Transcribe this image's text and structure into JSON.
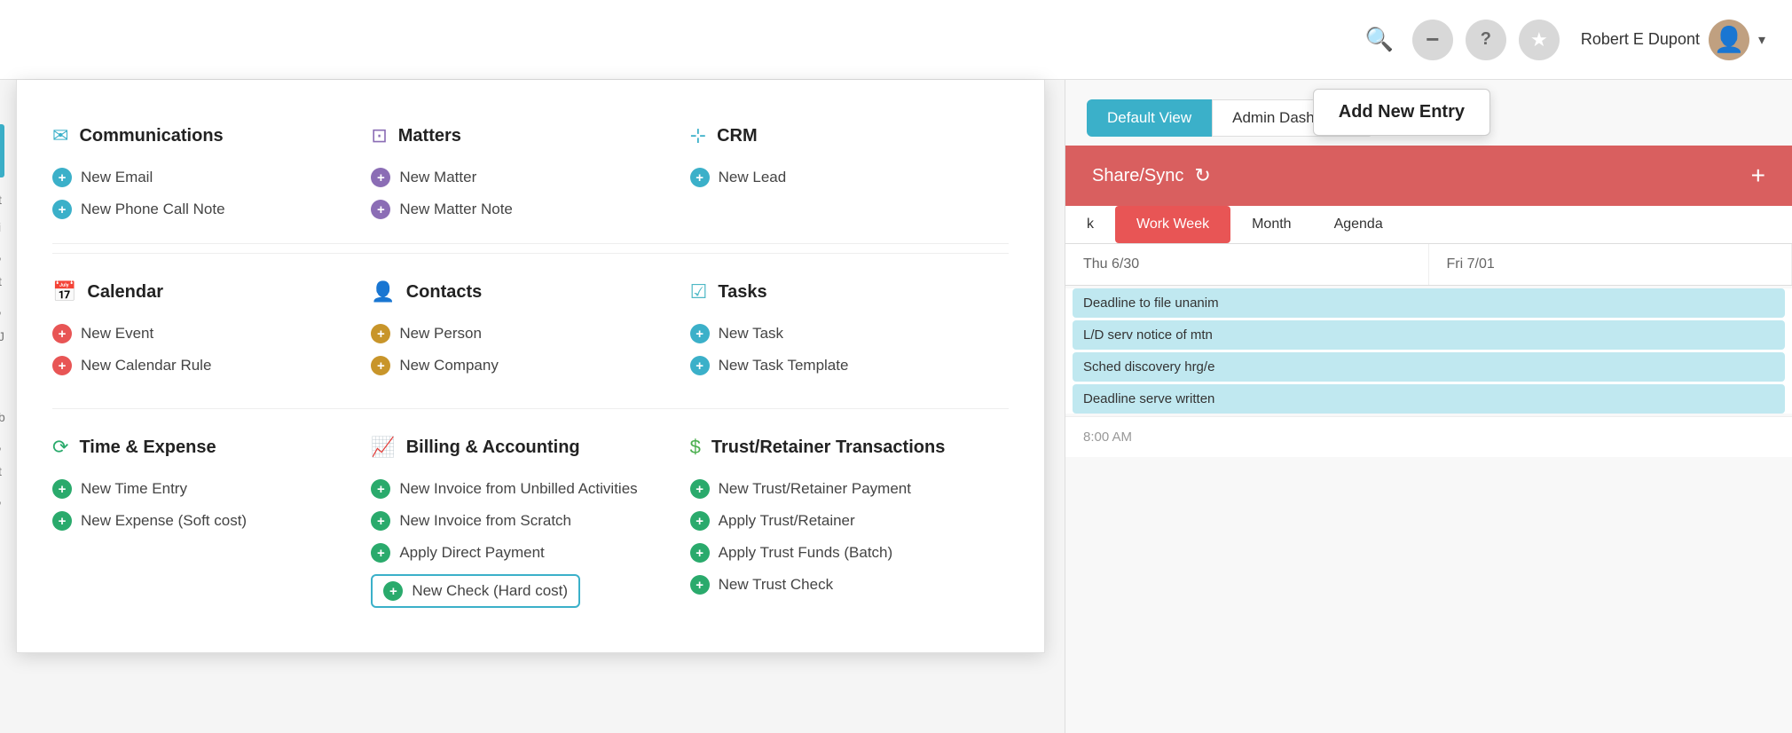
{
  "header": {
    "user_name": "Robert E Dupont",
    "search_icon": "🔍",
    "minus_icon": "−",
    "help_icon": "?",
    "star_icon": "★",
    "chevron": "▾"
  },
  "add_new_entry": {
    "label": "Add New Entry"
  },
  "categories": {
    "communications": {
      "title": "Communications",
      "items": [
        {
          "label": "New Email",
          "color": "teal"
        },
        {
          "label": "New Phone Call Note",
          "color": "teal"
        }
      ]
    },
    "matters": {
      "title": "Matters",
      "items": [
        {
          "label": "New Matter",
          "color": "purple"
        },
        {
          "label": "New Matter Note",
          "color": "purple"
        }
      ]
    },
    "crm": {
      "title": "CRM",
      "items": [
        {
          "label": "New Lead",
          "color": "teal"
        }
      ]
    },
    "calendar": {
      "title": "Calendar",
      "items": [
        {
          "label": "New Event",
          "color": "red"
        },
        {
          "label": "New Calendar Rule",
          "color": "red"
        }
      ]
    },
    "contacts": {
      "title": "Contacts",
      "items": [
        {
          "label": "New Person",
          "color": "gold"
        },
        {
          "label": "New Company",
          "color": "gold"
        }
      ]
    },
    "tasks": {
      "title": "Tasks",
      "items": [
        {
          "label": "New Task",
          "color": "teal"
        },
        {
          "label": "New Task Template",
          "color": "teal"
        }
      ]
    },
    "time_expense": {
      "title": "Time & Expense",
      "items": [
        {
          "label": "New Time Entry",
          "color": "green"
        },
        {
          "label": "New Expense (Soft cost)",
          "color": "green"
        }
      ]
    },
    "billing": {
      "title": "Billing & Accounting",
      "items": [
        {
          "label": "New Invoice from Unbilled Activities",
          "color": "green"
        },
        {
          "label": "New Invoice from Scratch",
          "color": "green"
        },
        {
          "label": "Apply Direct Payment",
          "color": "green"
        },
        {
          "label": "New Check (Hard cost)",
          "color": "green",
          "highlighted": true
        }
      ]
    },
    "trust": {
      "title": "Trust/Retainer Transactions",
      "items": [
        {
          "label": "New Trust/Retainer Payment",
          "color": "green"
        },
        {
          "label": "Apply Trust/Retainer",
          "color": "green"
        },
        {
          "label": "Apply Trust Funds (Batch)",
          "color": "green"
        },
        {
          "label": "New Trust Check",
          "color": "green"
        }
      ]
    }
  },
  "right_panel": {
    "default_view_label": "Default View",
    "admin_dashboard_label": "Admin Dashboard",
    "share_sync_label": "Share/Sync",
    "week_tabs": [
      "k",
      "Work Week",
      "Month",
      "Agenda"
    ],
    "calendar_days": [
      "Thu 6/30",
      "Fri 7/01"
    ],
    "events": [
      "Deadline to file unanim",
      "L/D serv notice of mtn",
      "Sched discovery hrg/e",
      "Deadline serve written"
    ]
  },
  "bottom_time": "8:00 AM"
}
